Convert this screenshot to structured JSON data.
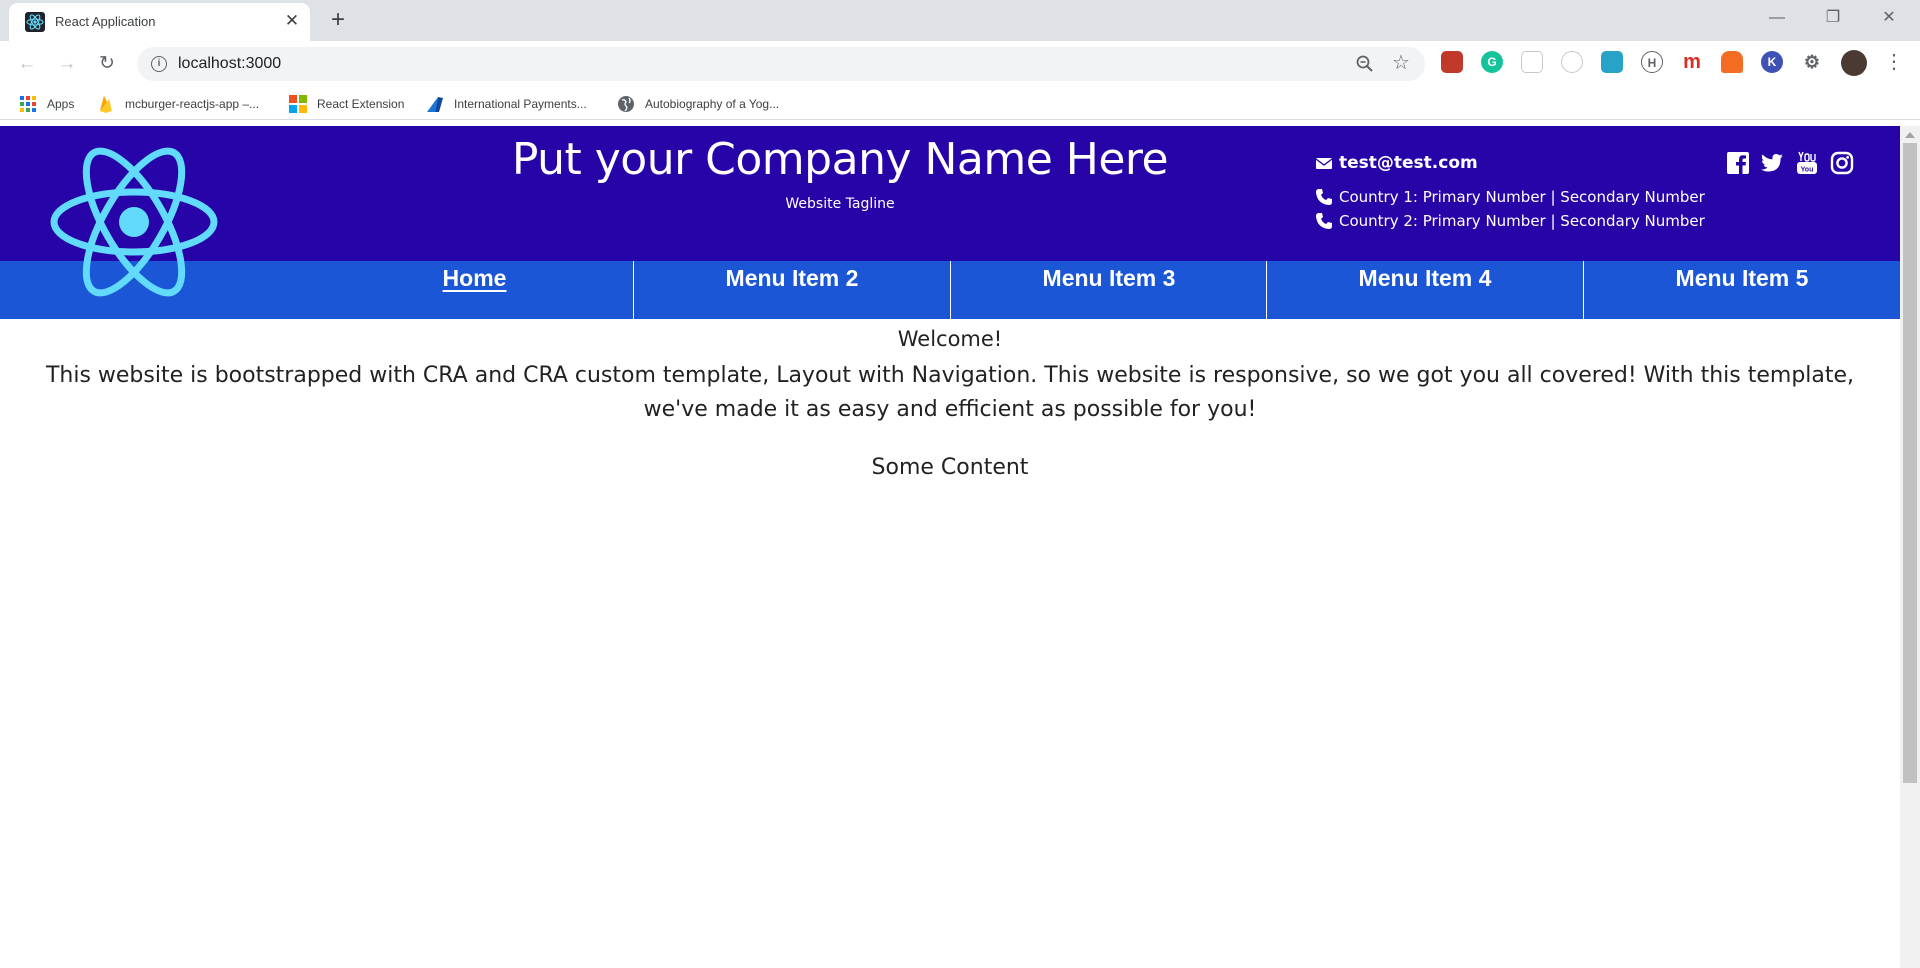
{
  "browser": {
    "tab_title": "React Application",
    "new_tab": "+",
    "close_tab": "✕",
    "url": "localhost:3000",
    "bookmarks": [
      {
        "label": "Apps",
        "icon": "apps-grid-icon"
      },
      {
        "label": "mcburger-reactjs-app –...",
        "icon": "firebase-icon"
      },
      {
        "label": "React Extension",
        "icon": "microsoft-icon"
      },
      {
        "label": "International Payments...",
        "icon": "payments-icon"
      },
      {
        "label": "Autobiography of a Yog...",
        "icon": "globe-icon"
      }
    ],
    "extensions": [
      "m"
    ]
  },
  "site": {
    "company_name": "Put your Company Name Here",
    "tagline": "Website Tagline",
    "email": "test@test.com",
    "phones": [
      "Country 1: Primary Number | Secondary Number",
      "Country 2: Primary Number | Secondary Number"
    ],
    "social": [
      "facebook-icon",
      "twitter-icon",
      "youtube-icon",
      "instagram-icon"
    ],
    "nav": [
      "Home",
      "Menu Item 2",
      "Menu Item 3",
      "Menu Item 4",
      "Menu Item 5"
    ],
    "colors": {
      "header": "#2704a8",
      "nav": "#1a56d6",
      "logo": "#61dafb"
    }
  },
  "content": {
    "welcome": "Welcome!",
    "intro": "This website is bootstrapped with CRA and CRA custom template, Layout with Navigation. This website is responsive, so we got you all covered! With this template, we've made it as easy and efficient as possible for you!",
    "body": "Some Content"
  }
}
